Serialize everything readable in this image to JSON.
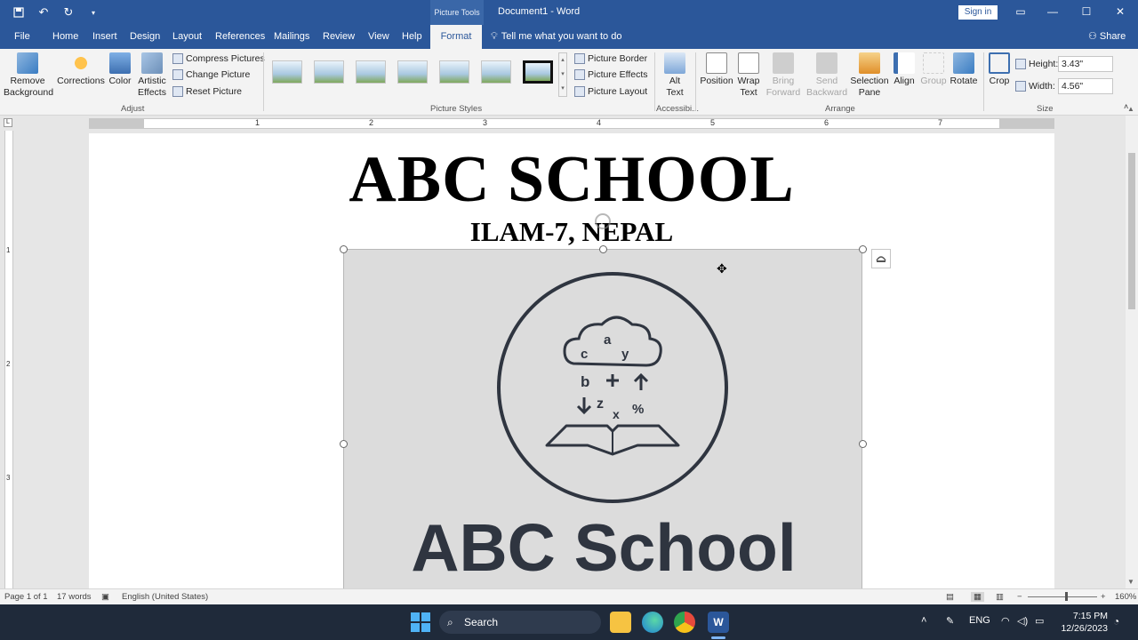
{
  "titlebar": {
    "context_tab_group": "Picture Tools",
    "document_title": "Document1  -  Word",
    "sign_in": "Sign in",
    "qat": [
      "save-icon",
      "undo-icon",
      "redo-icon",
      "customize-icon"
    ]
  },
  "tabs": [
    "File",
    "Home",
    "Insert",
    "Design",
    "Layout",
    "References",
    "Mailings",
    "Review",
    "View",
    "Help",
    "Format"
  ],
  "active_tab": "Format",
  "tell_me": "Tell me what you want to do",
  "share": "Share",
  "ribbon": {
    "adjust": {
      "label": "Adjust",
      "remove_background": "Remove Background",
      "corrections": "Corrections",
      "color": "Color",
      "artistic_effects": "Artistic Effects",
      "compress": "Compress Pictures",
      "change": "Change Picture",
      "reset": "Reset Picture"
    },
    "picture_styles": {
      "label": "Picture Styles",
      "border": "Picture Border",
      "effects": "Picture Effects",
      "layout": "Picture Layout"
    },
    "accessibility": {
      "label": "Accessibi...",
      "alt_text": "Alt Text"
    },
    "arrange": {
      "label": "Arrange",
      "position": "Position",
      "wrap_text": "Wrap Text",
      "bring_forward": "Bring Forward",
      "send_backward": "Send Backward",
      "selection_pane": "Selection Pane",
      "align": "Align",
      "group": "Group",
      "rotate": "Rotate"
    },
    "size": {
      "label": "Size",
      "crop": "Crop",
      "height_label": "Height:",
      "height_value": "3.43\"",
      "width_label": "Width:",
      "width_value": "4.56\""
    }
  },
  "ruler_numbers": [
    "1",
    "2",
    "3",
    "4",
    "5",
    "6",
    "7"
  ],
  "vruler_numbers": [
    "1",
    "2",
    "3"
  ],
  "document": {
    "heading": "ABC SCHOOL",
    "subheading": "ILAM-7, NEPAL",
    "logo_letters": [
      "c",
      "a",
      "y",
      "b",
      "z",
      "x",
      "%"
    ],
    "logo_text": "ABC School"
  },
  "statusbar": {
    "page": "Page 1 of 1",
    "words": "17 words",
    "language": "English (United States)",
    "zoom": "160%"
  },
  "taskbar": {
    "search": "Search",
    "lang": "ENG",
    "time": "7:15 PM",
    "date": "12/26/2023"
  }
}
